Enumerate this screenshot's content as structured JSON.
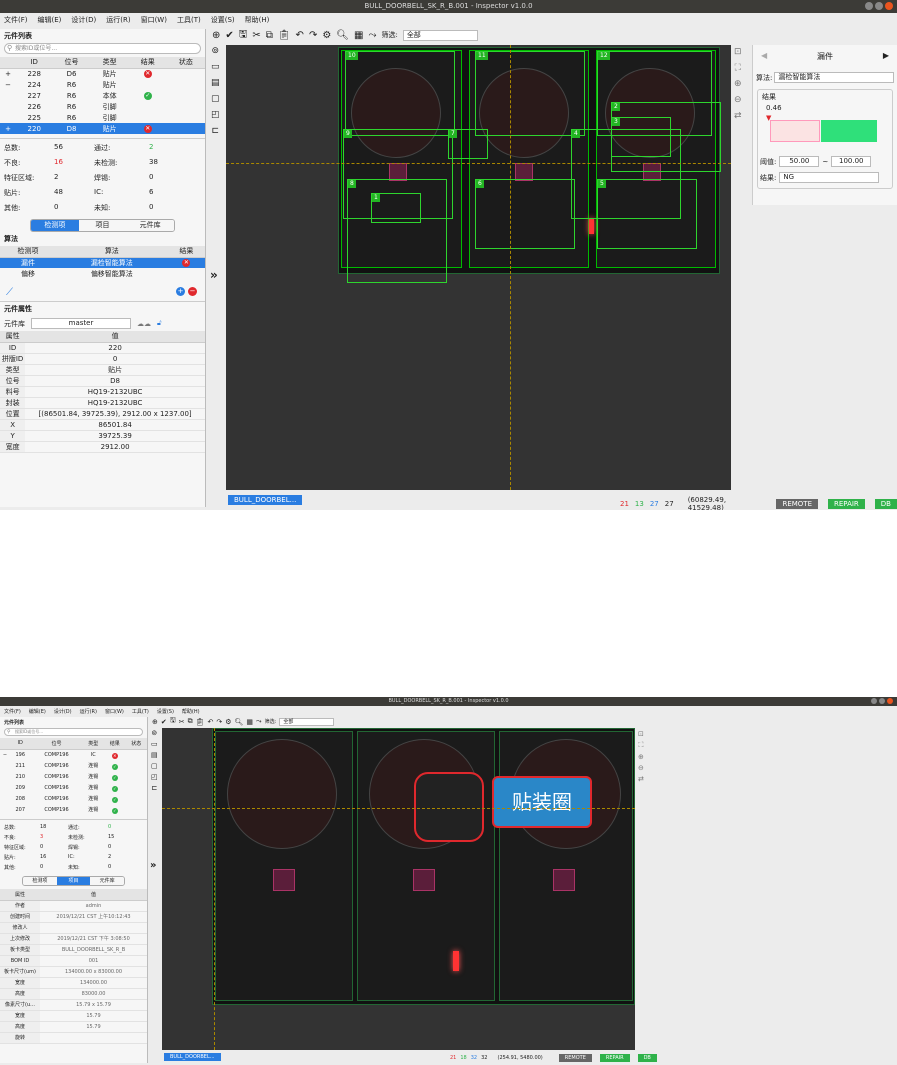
{
  "app": {
    "title": "BULL_DOORBELL_SK_R_B.001 - Inspector v1.0.0"
  },
  "menu": [
    "文件(F)",
    "编辑(E)",
    "设计(D)",
    "运行(R)",
    "窗口(W)",
    "工具(T)",
    "设置(S)",
    "帮助(H)"
  ],
  "filter": {
    "label": "筛选:",
    "value": "全部"
  },
  "s1": {
    "panel_title": "元件列表",
    "search_placeholder": "搜索ID或位号...",
    "cols": [
      "ID",
      "位号",
      "类型",
      "结果",
      "状态"
    ],
    "rows": [
      {
        "exp": "+",
        "id": "228",
        "ref": "D6",
        "type": "贴片",
        "res": "bad"
      },
      {
        "exp": "−",
        "id": "224",
        "ref": "R6",
        "type": "贴片",
        "res": ""
      },
      {
        "exp": "",
        "id": "227",
        "ref": "R6",
        "type": "本体",
        "res": "ok"
      },
      {
        "exp": "",
        "id": "226",
        "ref": "R6",
        "type": "引脚",
        "res": ""
      },
      {
        "exp": "",
        "id": "225",
        "ref": "R6",
        "type": "引脚",
        "res": ""
      },
      {
        "exp": "+",
        "id": "220",
        "ref": "D8",
        "type": "贴片",
        "res": "bad"
      }
    ],
    "stats": [
      [
        "总数:",
        "56",
        "通过:",
        "2"
      ],
      [
        "不良:",
        "16",
        "未检测:",
        "38"
      ],
      [
        "特征区域:",
        "2",
        "焊锡:",
        "0"
      ],
      [
        "贴片:",
        "48",
        "IC:",
        "6"
      ],
      [
        "其他:",
        "0",
        "未知:",
        "0"
      ]
    ],
    "tabs": [
      "检测项",
      "项目",
      "元件库"
    ],
    "algo_title": "算法",
    "algo_cols": [
      "检测项",
      "算法",
      "结果"
    ],
    "algo_rows": [
      {
        "item": "漏件",
        "algo": "漏检智能算法",
        "res": "bad"
      },
      {
        "item": "偏移",
        "algo": "偏移智能算法",
        "res": ""
      }
    ],
    "props_title": "元件属性",
    "lib_label": "元件库",
    "lib_value": "master",
    "prop_cols": [
      "属性",
      "值"
    ],
    "props": [
      [
        "ID",
        "220"
      ],
      [
        "拼版ID",
        "0"
      ],
      [
        "类型",
        "贴片"
      ],
      [
        "位号",
        "D8"
      ],
      [
        "料号",
        "HQ19-2132UBC"
      ],
      [
        "封装",
        "HQ19-2132UBC"
      ],
      [
        "位置",
        "[(86501.84, 39725.39), 2912.00 x 1237.00]"
      ],
      [
        "X",
        "86501.84"
      ],
      [
        "Y",
        "39725.39"
      ],
      [
        "宽度",
        "2912.00"
      ]
    ],
    "tags": [
      "10",
      "11",
      "12",
      "9",
      "7",
      "4",
      "2",
      "3",
      "8",
      "6",
      "5",
      "1"
    ],
    "right": {
      "title": "漏件",
      "algo_label": "算法:",
      "algo_value": "漏检智能算法",
      "result_group": "结果",
      "score": "0.46",
      "thr_label": "阈值:",
      "thr_min": "50.00",
      "tilde": "~",
      "thr_max": "100.00",
      "result_label": "结果:",
      "result_value": "NG"
    },
    "status": {
      "doc": "BULL_DOORBEL...",
      "n1": "21",
      "n2": "13",
      "n3": "27",
      "n4": "27",
      "coord": "(60829.49, 41529.48)",
      "b1": "REMOTE",
      "b2": "REPAIR",
      "b3": "DB"
    }
  },
  "s2": {
    "cols": [
      "ID",
      "位号",
      "类型",
      "结果",
      "状态"
    ],
    "rows": [
      {
        "exp": "−",
        "id": "196",
        "ref": "COMP196",
        "type": "IC",
        "res": "bad"
      },
      {
        "exp": "",
        "id": "211",
        "ref": "COMP196",
        "type": "连锡",
        "res": "ok"
      },
      {
        "exp": "",
        "id": "210",
        "ref": "COMP196",
        "type": "连锡",
        "res": "ok"
      },
      {
        "exp": "",
        "id": "209",
        "ref": "COMP196",
        "type": "连锡",
        "res": "ok"
      },
      {
        "exp": "",
        "id": "208",
        "ref": "COMP196",
        "type": "连锡",
        "res": "ok"
      },
      {
        "exp": "",
        "id": "207",
        "ref": "COMP196",
        "type": "连锡",
        "res": "ok"
      }
    ],
    "stats": [
      [
        "总数:",
        "18",
        "通过:",
        "0"
      ],
      [
        "不良:",
        "3",
        "未检测:",
        "15"
      ],
      [
        "特征区域:",
        "0",
        "焊锡:",
        "0"
      ],
      [
        "贴片:",
        "16",
        "IC:",
        "2"
      ],
      [
        "其他:",
        "0",
        "未知:",
        "0"
      ]
    ],
    "prop_cols": [
      "属性",
      "值"
    ],
    "props": [
      [
        "作者",
        "admin"
      ],
      [
        "创建时间",
        "2019/12/21 CST 上午10:12:43"
      ],
      [
        "修改人",
        ""
      ],
      [
        "上次修改",
        "2019/12/21 CST 下午 3:08:50"
      ],
      [
        "板卡类型",
        "BULL_DOORBELL_SK_R_B"
      ],
      [
        "BOM ID",
        "001"
      ],
      [
        "板卡尺寸(um)",
        "134000.00 x 83000.00"
      ],
      [
        "宽度",
        "134000.00"
      ],
      [
        "高度",
        "83000.00"
      ],
      [
        "像素尺寸(u...",
        "15.79 x 15.79"
      ],
      [
        "宽度",
        "15.79"
      ],
      [
        "高度",
        "15.79"
      ],
      [
        "旋转",
        ""
      ]
    ],
    "badge": "贴装圈",
    "status": {
      "doc": "BULL_DOORBEL...",
      "n1": "21",
      "n2": "18",
      "n3": "32",
      "n4": "32",
      "coord": "(254.91, 5480.00)",
      "b1": "REMOTE",
      "b2": "REPAIR",
      "b3": "DB"
    }
  }
}
